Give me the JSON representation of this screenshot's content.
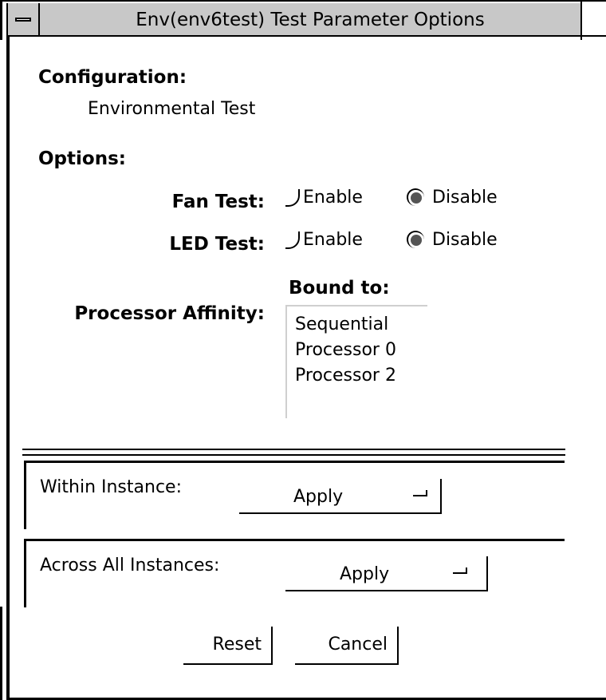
{
  "window": {
    "title": "Env(env6test) Test Parameter Options"
  },
  "configuration": {
    "heading": "Configuration:",
    "value": "Environmental Test"
  },
  "options": {
    "heading": "Options:",
    "fan_test": {
      "label": "Fan Test:",
      "enable_label": "Enable",
      "disable_label": "Disable",
      "selected": "Disable"
    },
    "led_test": {
      "label": "LED Test:",
      "enable_label": "Enable",
      "disable_label": "Disable",
      "selected": "Disable"
    },
    "processor_affinity": {
      "label": "Processor Affinity:",
      "bound_to_label": "Bound to:",
      "items": [
        "Sequential",
        "Processor 0",
        "Processor 2"
      ]
    }
  },
  "within_instance": {
    "label": "Within Instance:",
    "value": "Apply"
  },
  "across_instances": {
    "label": "Across All Instances:",
    "value": "Apply"
  },
  "buttons": {
    "reset": "Reset",
    "cancel": "Cancel"
  }
}
